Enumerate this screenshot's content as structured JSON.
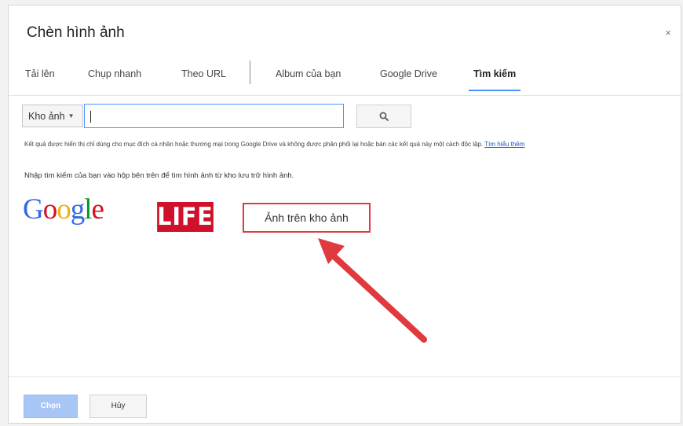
{
  "dialog": {
    "title": "Chèn hình ảnh",
    "close_label": "×"
  },
  "tabs": [
    {
      "label": "Tải lên",
      "active": false
    },
    {
      "label": "Chụp nhanh",
      "active": false
    },
    {
      "label": "Theo URL",
      "active": false
    },
    {
      "label": "Album của bạn",
      "active": false
    },
    {
      "label": "Google Drive",
      "active": false
    },
    {
      "label": "Tìm kiếm",
      "active": true
    }
  ],
  "search": {
    "source_label": "Kho ảnh",
    "value": "",
    "button_icon": "search-icon"
  },
  "disclaimer": {
    "text": "Kết quả được hiển thị chỉ dùng cho mục đích cá nhân hoặc thương mại trong Google Drive và không được phân phối lại hoặc bán các kết quả này một cách độc lập.",
    "link": "Tìm hiểu thêm"
  },
  "hint": "Nhập tìm kiếm của bạn vào hộp bên trên để tìm hình ảnh từ kho lưu trữ hình ảnh.",
  "providers": {
    "google_letters": [
      "G",
      "o",
      "o",
      "g",
      "l",
      "e"
    ],
    "google_colors": [
      "#3369e8",
      "#d50f25",
      "#eeb211",
      "#3369e8",
      "#009925",
      "#d50f25"
    ],
    "life_label": "LIFE",
    "stock_label": "Ảnh trên kho ảnh"
  },
  "footer": {
    "select_label": "Chọn",
    "cancel_label": "Hủy"
  },
  "colors": {
    "accent": "#4d90fe",
    "highlight_red": "#e0393e",
    "life_red": "#d0112b"
  }
}
